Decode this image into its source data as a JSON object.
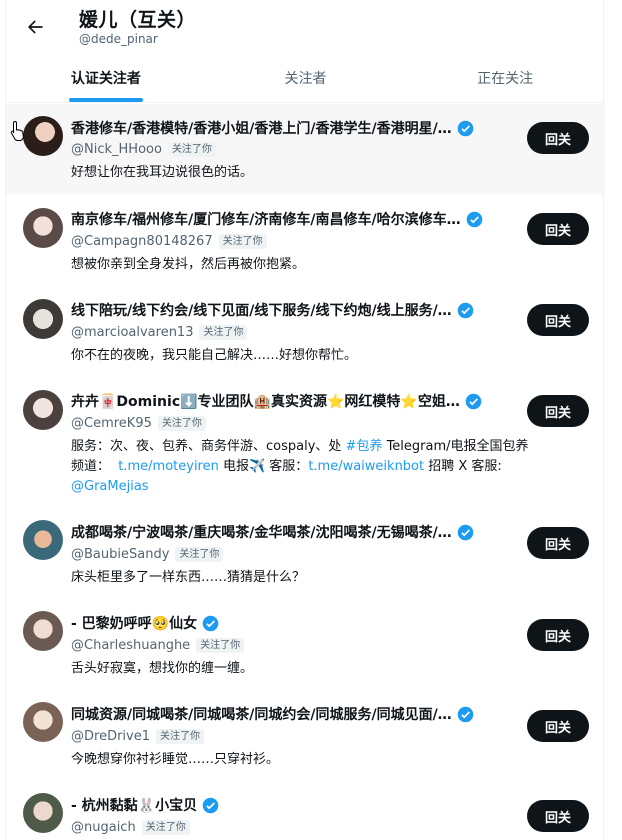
{
  "header": {
    "title": "媛儿（互关）",
    "handle": "@dede_pinar"
  },
  "tabs": [
    {
      "label": "认证关注者",
      "active": true
    },
    {
      "label": "关注者",
      "active": false
    },
    {
      "label": "正在关注",
      "active": false
    }
  ],
  "follows_you_label": "关注了你",
  "follow_back_label": "回关",
  "colors": {
    "accent": "#1d9bf0",
    "button": "#0f1419",
    "muted": "#536471"
  },
  "users": [
    {
      "name": "香港修车/香港模特/香港小姐/香港上门/香港学生/香港明星/…",
      "handle": "@Nick_HHooo",
      "bio": "好想让你在我耳边说很色的话。",
      "verified": true,
      "follows_you": true
    },
    {
      "name": "南京修车/福州修车/厦门修车/济南修车/南昌修车/哈尔滨修车…",
      "handle": "@Campagn80148267",
      "bio": "想被你亲到全身发抖，然后再被你抱紧。",
      "verified": true,
      "follows_you": true
    },
    {
      "name": "线下陪玩/线下约会/线下见面/线下服务/线下约炮/线上服务/…",
      "handle": "@marcioalvaren13",
      "bio": "你不在的夜晚，我只能自己解决……好想你帮忙。",
      "verified": true,
      "follows_you": true
    },
    {
      "name": "卉卉🀄Dominic⬇️专业团队🏨真实资源⭐网红模特⭐空姐…",
      "handle": "@CemreK95",
      "bio_parts": {
        "line1_text": "服务：次、夜、包养、商务伴游、cospaly、处 ",
        "line1_hashtag": "#包养",
        "line1_rest": " Telegram/电报全国包养",
        "line2_prefix": "频道：  ",
        "line2_link1": "t.me/moteyiren",
        "line2_mid": " 电报✈️ 客服：",
        "line2_link2": "t.me/waiweiknbot",
        "line2_suffix": " 招聘 X 客服:",
        "line3_mention": "@GraMejias"
      },
      "verified": true,
      "follows_you": true
    },
    {
      "name": "成都喝茶/宁波喝茶/重庆喝茶/金华喝茶/沈阳喝茶/无锡喝茶/…",
      "handle": "@BaubieSandy",
      "bio": "床头柜里多了一样东西……猜猜是什么？",
      "verified": true,
      "follows_you": true
    },
    {
      "name": "- 巴黎奶呼呼🥺仙女",
      "handle": "@Charleshuanghe",
      "bio": "舌头好寂寞，想找你的缠一缠。",
      "verified": true,
      "follows_you": true
    },
    {
      "name": "同城资源/同城喝茶/同城喝茶/同城约会/同城服务/同城见面/…",
      "handle": "@DreDrive1",
      "bio": "今晚想穿你衬衫睡觉……只穿衬衫。",
      "verified": true,
      "follows_you": true
    },
    {
      "name": "- 杭州黏黏🐰小宝贝",
      "handle": "@nugaich",
      "bio": "",
      "verified": true,
      "follows_you": true
    }
  ]
}
